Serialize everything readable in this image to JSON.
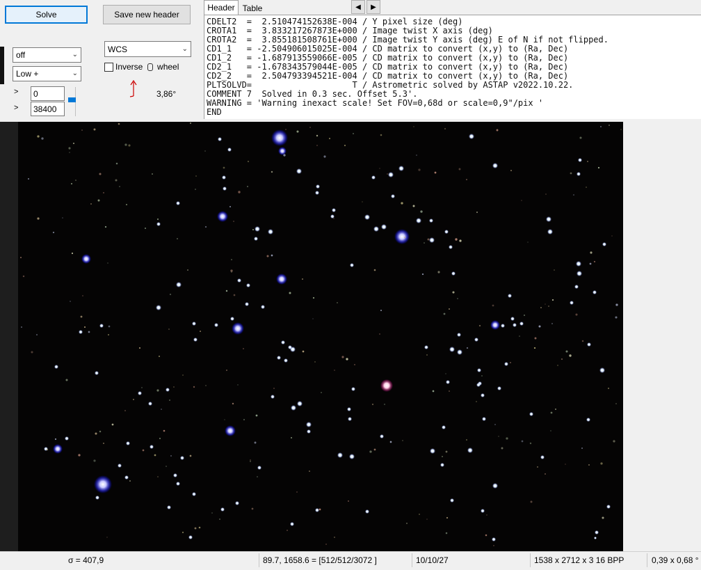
{
  "toolbar": {
    "solve_label": "Solve",
    "save_header_label": "Save new header",
    "stretch_select": "off",
    "quality_select": "Low +",
    "min_value": "0",
    "max_value": "38400",
    "projection_select": "WCS",
    "inverse_wheel_label": "Inverse",
    "wheel_label": "wheel",
    "rotation_angle": "3,86°"
  },
  "tabs": {
    "header": "Header",
    "table": "Table"
  },
  "header_lines": [
    "CDELT2  =  2.510474152638E-004 / Y pixel size (deg)",
    "CROTA1  =  3.833217267873E+000 / Image twist X axis (deg)",
    "CROTA2  =  3.855181508761E+000 / Image twist Y axis (deg) E of N if not flipped.",
    "CD1_1   = -2.504906015025E-004 / CD matrix to convert (x,y) to (Ra, Dec)",
    "CD1_2   = -1.687913559066E-005 / CD matrix to convert (x,y) to (Ra, Dec)",
    "CD2_1   = -1.678343579044E-005 / CD matrix to convert (x,y) to (Ra, Dec)",
    "CD2_2   =  2.504793394521E-004 / CD matrix to convert (x,y) to (Ra, Dec)",
    "PLTSOLVD=                    T / Astrometric solved by ASTAP v2022.10.22.",
    "COMMENT 7  Solved in 0.3 sec. Offset 5.3'.",
    "WARNING = 'Warning inexact scale! Set FOV=0,68d or scale=0,9\"/pix '",
    "END"
  ],
  "status": {
    "sigma": "σ = 407,9",
    "coords": "89.7, 1658.6 = [512/512/3072 ]",
    "date": "10/10/27",
    "dimensions": "1538 x 2712 x 3  16 BPP",
    "fov": "0,39 x 0,68 °"
  },
  "colors": {
    "sky": "#050404",
    "accent": "#0078d7",
    "arrow": "#cc0000"
  }
}
